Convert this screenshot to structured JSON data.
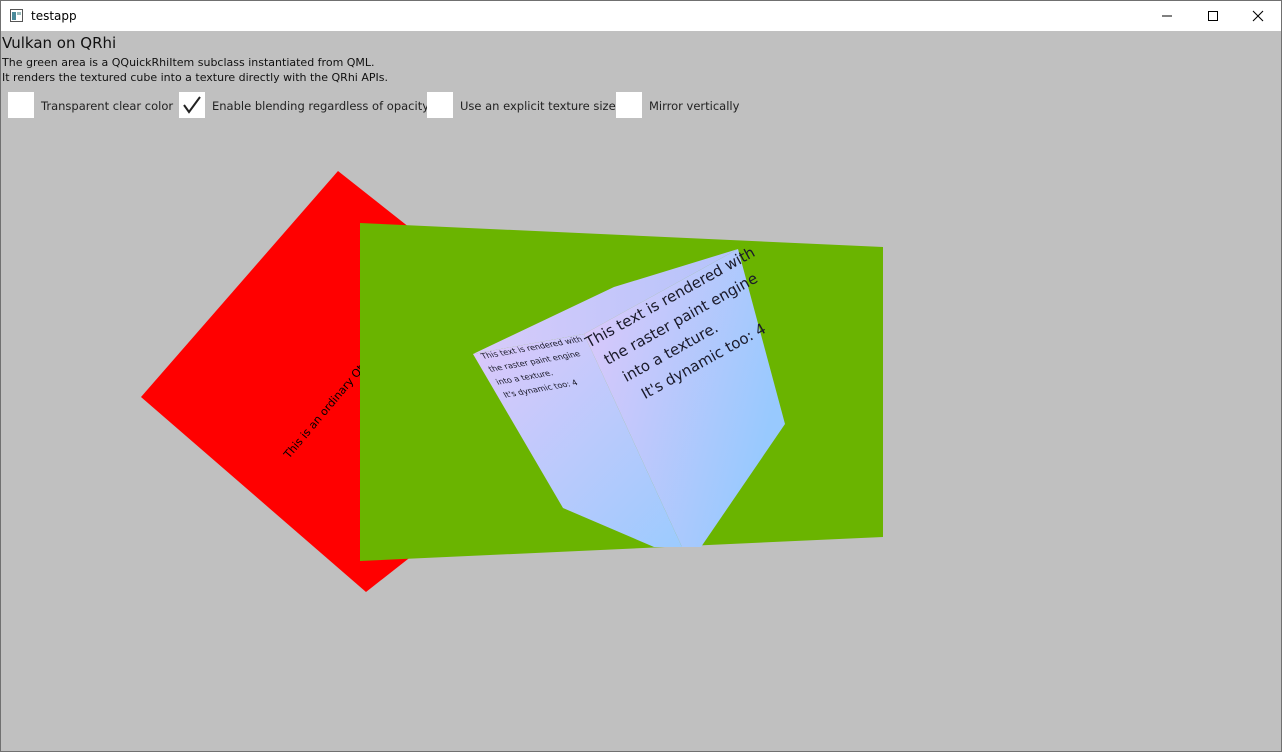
{
  "window": {
    "title": "testapp",
    "icon": "app-window-icon",
    "controls": [
      "minimize-icon",
      "maximize-icon",
      "close-icon"
    ]
  },
  "header": {
    "title": "Vulkan on QRhi",
    "line1": "The green area is a QQuickRhiItem subclass instantiated from QML.",
    "line2": "It renders the textured cube into a texture directly with the QRhi APIs."
  },
  "options": [
    {
      "label": "Transparent clear color",
      "checked": false
    },
    {
      "label": "Enable blending regardless of opacity",
      "checked": true
    },
    {
      "label": "Use an explicit texture size",
      "checked": false
    },
    {
      "label": "Mirror vertically",
      "checked": false
    }
  ],
  "scene": {
    "red_item_text": "This is an ordinary Qt Quick",
    "cube_text": [
      "This text is rendered with",
      "the raster paint engine",
      "into a texture.",
      "It's dynamic too: 4"
    ],
    "colors": {
      "background": "#c0c0c0",
      "red": "#ff0000",
      "green": "#6ab400",
      "cube_a": "#d6c6f8",
      "cube_b": "#9ccbfe"
    }
  }
}
